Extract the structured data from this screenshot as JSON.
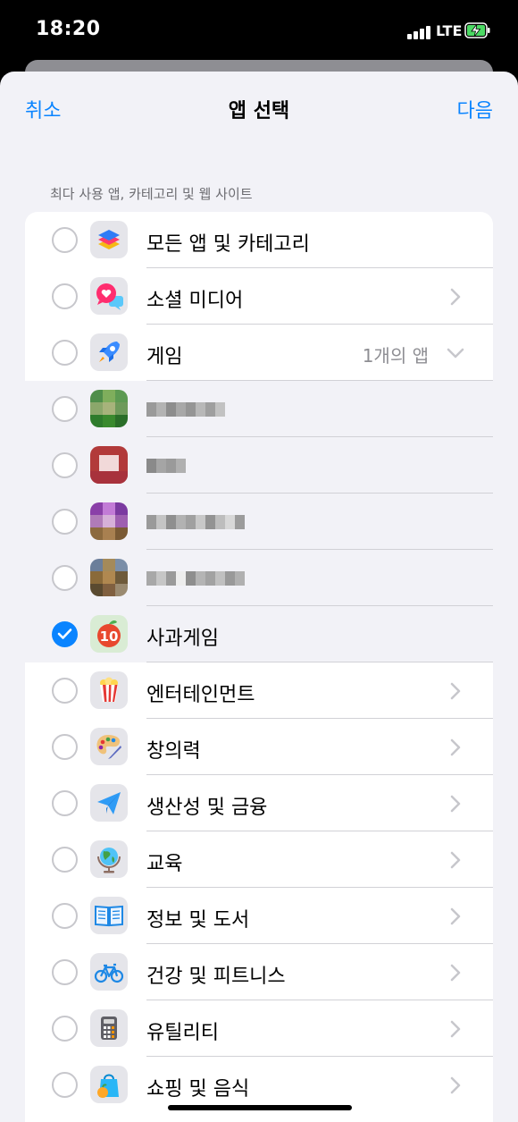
{
  "status": {
    "time": "18:20",
    "network": "LTE"
  },
  "nav": {
    "cancel": "취소",
    "title": "앱 선택",
    "next": "다음"
  },
  "section_header": "최다 사용 앱, 카테고리 및 웹 사이트",
  "rows": [
    {
      "label": "모든 앱 및 카테고리",
      "checked": false,
      "icon": "stack-icon"
    },
    {
      "label": "소셜 미디어",
      "checked": false,
      "icon": "chat-bubbles-icon"
    },
    {
      "label": "게임",
      "detail": "1개의 앱",
      "checked": false,
      "icon": "rocket-icon"
    },
    {
      "label": "",
      "checked": false,
      "icon": "blurred-app-icon"
    },
    {
      "label": "",
      "checked": false,
      "icon": "blurred-app-icon"
    },
    {
      "label": "",
      "checked": false,
      "icon": "blurred-app-icon"
    },
    {
      "label": "",
      "checked": false,
      "icon": "blurred-app-icon"
    },
    {
      "label": "사과게임",
      "checked": true,
      "icon": "apple-game-icon"
    },
    {
      "label": "엔터테인먼트",
      "checked": false,
      "icon": "popcorn-icon"
    },
    {
      "label": "창의력",
      "checked": false,
      "icon": "palette-icon"
    },
    {
      "label": "생산성 및 금융",
      "checked": false,
      "icon": "paper-plane-icon"
    },
    {
      "label": "교육",
      "checked": false,
      "icon": "globe-icon"
    },
    {
      "label": "정보 및 도서",
      "checked": false,
      "icon": "book-icon"
    },
    {
      "label": "건강 및 피트니스",
      "checked": false,
      "icon": "bicycle-icon"
    },
    {
      "label": "유틸리티",
      "checked": false,
      "icon": "calculator-icon"
    },
    {
      "label": "쇼핑 및 음식",
      "checked": false,
      "icon": "shopping-bag-icon"
    }
  ],
  "apple_game_badge": "10",
  "colors": {
    "accent": "#0a84ff",
    "background": "#f2f2f7"
  }
}
